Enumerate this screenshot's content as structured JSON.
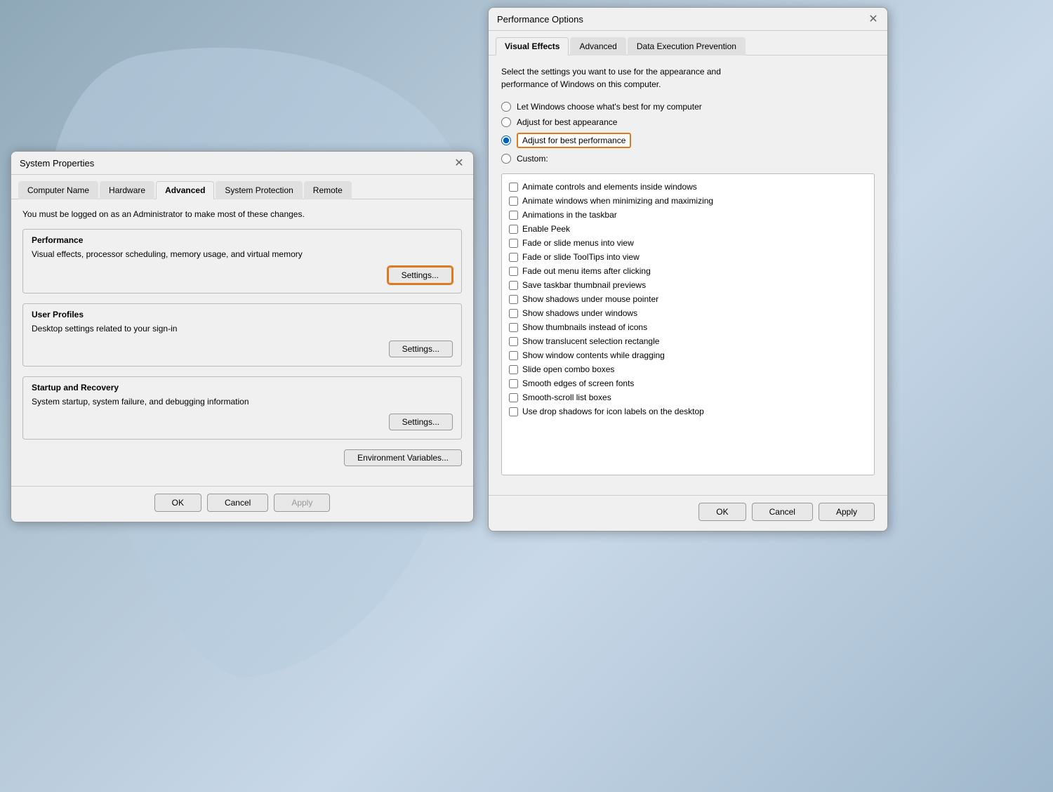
{
  "systemProperties": {
    "title": "System Properties",
    "tabs": [
      {
        "id": "computer-name",
        "label": "Computer Name",
        "active": false
      },
      {
        "id": "hardware",
        "label": "Hardware",
        "active": false
      },
      {
        "id": "advanced",
        "label": "Advanced",
        "active": true
      },
      {
        "id": "system-protection",
        "label": "System Protection",
        "active": false
      },
      {
        "id": "remote",
        "label": "Remote",
        "active": false
      }
    ],
    "adminNote": "You must be logged on as an Administrator to make most of these changes.",
    "performance": {
      "label": "Performance",
      "description": "Visual effects, processor scheduling, memory usage, and virtual memory",
      "settingsLabel": "Settings..."
    },
    "userProfiles": {
      "label": "User Profiles",
      "description": "Desktop settings related to your sign-in",
      "settingsLabel": "Settings..."
    },
    "startupRecovery": {
      "label": "Startup and Recovery",
      "description": "System startup, system failure, and debugging information",
      "settingsLabel": "Settings..."
    },
    "envVarsLabel": "Environment Variables...",
    "footer": {
      "ok": "OK",
      "cancel": "Cancel",
      "apply": "Apply"
    }
  },
  "performanceOptions": {
    "title": "Performance Options",
    "tabs": [
      {
        "id": "visual-effects",
        "label": "Visual Effects",
        "active": true
      },
      {
        "id": "advanced",
        "label": "Advanced",
        "active": false
      },
      {
        "id": "dep",
        "label": "Data Execution Prevention",
        "active": false
      }
    ],
    "description": "Select the settings you want to use for the appearance and\nperformance of Windows on this computer.",
    "radioOptions": [
      {
        "id": "let-windows",
        "label": "Let Windows choose what's best for my computer",
        "selected": false
      },
      {
        "id": "best-appearance",
        "label": "Adjust for best appearance",
        "selected": false
      },
      {
        "id": "best-performance",
        "label": "Adjust for best performance",
        "selected": true
      },
      {
        "id": "custom",
        "label": "Custom:",
        "selected": false
      }
    ],
    "checkboxItems": [
      {
        "label": "Animate controls and elements inside windows",
        "checked": false
      },
      {
        "label": "Animate windows when minimizing and maximizing",
        "checked": false
      },
      {
        "label": "Animations in the taskbar",
        "checked": false
      },
      {
        "label": "Enable Peek",
        "checked": false
      },
      {
        "label": "Fade or slide menus into view",
        "checked": false
      },
      {
        "label": "Fade or slide ToolTips into view",
        "checked": false
      },
      {
        "label": "Fade out menu items after clicking",
        "checked": false
      },
      {
        "label": "Save taskbar thumbnail previews",
        "checked": false
      },
      {
        "label": "Show shadows under mouse pointer",
        "checked": false
      },
      {
        "label": "Show shadows under windows",
        "checked": false
      },
      {
        "label": "Show thumbnails instead of icons",
        "checked": false
      },
      {
        "label": "Show translucent selection rectangle",
        "checked": false
      },
      {
        "label": "Show window contents while dragging",
        "checked": false
      },
      {
        "label": "Slide open combo boxes",
        "checked": false
      },
      {
        "label": "Smooth edges of screen fonts",
        "checked": false
      },
      {
        "label": "Smooth-scroll list boxes",
        "checked": false
      },
      {
        "label": "Use drop shadows for icon labels on the desktop",
        "checked": false
      }
    ],
    "footer": {
      "ok": "OK",
      "cancel": "Cancel",
      "apply": "Apply"
    }
  },
  "icons": {
    "close": "✕"
  }
}
